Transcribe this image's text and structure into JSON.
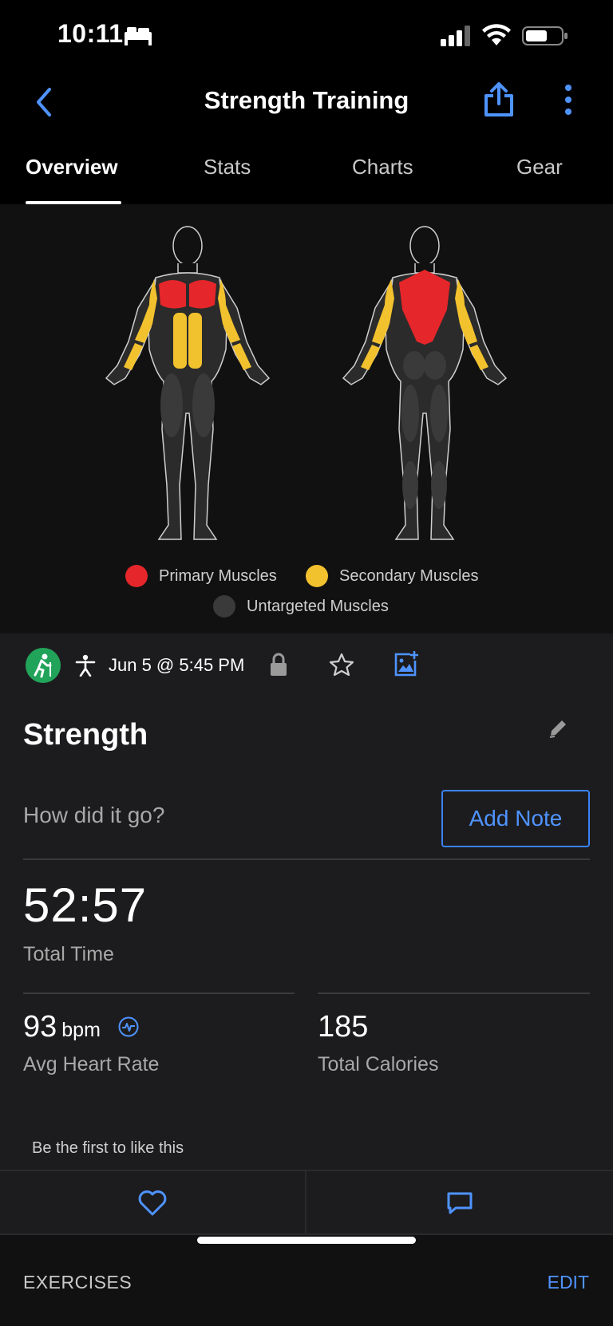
{
  "status": {
    "time": "10:11"
  },
  "nav": {
    "title": "Strength Training"
  },
  "tabs": [
    {
      "label": "Overview",
      "active": true
    },
    {
      "label": "Stats",
      "active": false
    },
    {
      "label": "Charts",
      "active": false
    },
    {
      "label": "Gear",
      "active": false
    }
  ],
  "legend": {
    "primary": {
      "label": "Primary Muscles",
      "color": "#e5262a"
    },
    "secondary": {
      "label": "Secondary Muscles",
      "color": "#f2c12e"
    },
    "untargeted": {
      "label": "Untargeted Muscles",
      "color": "#3a3a3a"
    }
  },
  "activity": {
    "date": "Jun 5 @ 5:45 PM",
    "name": "Strength",
    "note_prompt": "How did it go?",
    "add_note_label": "Add Note"
  },
  "stats": {
    "total_time": {
      "value": "52:57",
      "label": "Total Time"
    },
    "avg_heart_rate": {
      "value": "93",
      "unit": "bpm",
      "label": "Avg Heart Rate"
    },
    "total_calories": {
      "value": "185",
      "label": "Total Calories"
    }
  },
  "social": {
    "likes_text": "Be the first to like this"
  },
  "exercises": {
    "title": "EXERCISES",
    "edit_label": "EDIT"
  },
  "colors": {
    "accent": "#4f93ff",
    "activity_icon": "#22a35a"
  }
}
